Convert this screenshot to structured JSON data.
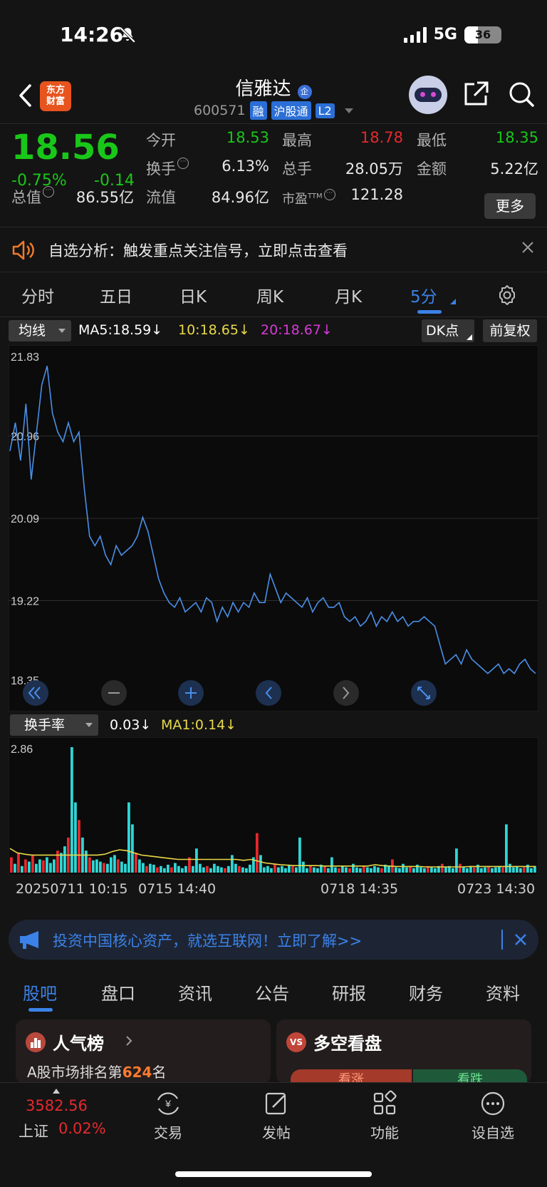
{
  "status_bar": {
    "time": "14:26",
    "network": "5G",
    "battery": "36"
  },
  "header": {
    "logo_line1": "东方",
    "logo_line2": "财富",
    "stock_name": "信雅达",
    "stock_badge": "企",
    "code": "600571",
    "tags": [
      "融",
      "沪股通",
      "L2"
    ]
  },
  "quote": {
    "price": "18.56",
    "change_pct": "-0.75%",
    "change_abs": "-0.14",
    "total_value_label": "总值",
    "total_value": "86.55亿",
    "rows": [
      [
        {
          "label": "今开",
          "value": "18.53",
          "color": "green"
        },
        {
          "label": "最高",
          "value": "18.78",
          "color": "red"
        },
        {
          "label": "最低",
          "value": "18.35",
          "color": "green"
        }
      ],
      [
        {
          "label": "换手",
          "value": "6.13%",
          "color": "white"
        },
        {
          "label": "总手",
          "value": "28.05万",
          "color": "white"
        },
        {
          "label": "金额",
          "value": "5.22亿",
          "color": "white"
        }
      ],
      [
        {
          "label": "流值",
          "value": "84.96亿",
          "color": "white"
        },
        {
          "label": "市盈",
          "value": "121.28",
          "color": "white"
        }
      ]
    ],
    "pe_superscript": "TTM",
    "more_label": "更多"
  },
  "notice": {
    "text": "自选分析：触发重点关注信号，立即点击查看"
  },
  "chart_tabs": {
    "items": [
      "分时",
      "五日",
      "日K",
      "周K",
      "月K",
      "5分"
    ],
    "active": "5分"
  },
  "ma_row": {
    "dropdown": "均线",
    "ma5": "MA5:18.59",
    "ma10": "10:18.65",
    "ma20": "20:18.67",
    "arrow": "↓",
    "dk_label": "DK点",
    "fq_label": "前复权"
  },
  "vol_row": {
    "dropdown": "换手率",
    "value": "0.03",
    "ma_label": "MA1:0.14",
    "arrow": "↓"
  },
  "x_labels": [
    "20250711 10:15",
    "0715 14:40",
    "0718 14:35",
    "0723 14:30"
  ],
  "ad": {
    "text": "投资中国核心资产，就选互联网！立即了解>>"
  },
  "section_tabs": {
    "items": [
      "股吧",
      "盘口",
      "资讯",
      "公告",
      "研报",
      "财务",
      "资料"
    ],
    "active": "股吧"
  },
  "cards": {
    "popularity_title": "人气榜",
    "popularity_sub_prefix": "A股市场排名第",
    "popularity_rank": "624",
    "popularity_sub_suffix": "名",
    "longshort_title": "多空看盘",
    "longshort_badge": "VS",
    "up_label": "看涨",
    "down_label": "看跌"
  },
  "bottom_bar": {
    "index_value": "3582.56",
    "index_name": "上证",
    "index_pct": "0.02%",
    "items": [
      "交易",
      "发帖",
      "功能",
      "设自选"
    ]
  },
  "colors": {
    "up": "#e5292e",
    "down": "#19c719",
    "accent": "#3b82e8",
    "price_line": "#4a8fe8",
    "ma_yellow": "#e8d84a",
    "ma_magenta": "#d63ad6",
    "vol_cyan": "#2fd6d6"
  },
  "chart_data": [
    {
      "type": "line",
      "title": "",
      "y_ticks": [
        "21.83",
        "20.96",
        "20.09",
        "19.22",
        "18.35"
      ],
      "ylim": [
        18.35,
        21.83
      ],
      "x_tick_labels": [
        "20250711 10:15",
        "0715 14:40",
        "0718 14:35",
        "0723 14:30"
      ],
      "series": [
        {
          "values": [
            20.8,
            21.1,
            20.7,
            21.3,
            20.5,
            21.0,
            21.5,
            21.7,
            21.2,
            21.0,
            20.9,
            21.1,
            20.9,
            21.0,
            20.4,
            19.9,
            19.8,
            19.9,
            19.7,
            19.6,
            19.8,
            19.7,
            19.75,
            19.8,
            19.9,
            20.1,
            19.95,
            19.7,
            19.45,
            19.3,
            19.2,
            19.15,
            19.25,
            19.1,
            19.15,
            19.2,
            19.1,
            19.25,
            19.2,
            19.0,
            19.15,
            19.05,
            19.2,
            19.1,
            19.2,
            19.15,
            19.3,
            19.2,
            19.2,
            19.5,
            19.35,
            19.2,
            19.3,
            19.25,
            19.2,
            19.15,
            19.25,
            19.1,
            19.2,
            19.25,
            19.15,
            19.15,
            19.2,
            19.05,
            19.0,
            19.05,
            18.95,
            19.0,
            19.1,
            18.95,
            19.05,
            19.0,
            19.1,
            19.0,
            19.05,
            18.95,
            19.0,
            19.0,
            19.05,
            19.0,
            18.95,
            18.75,
            18.55,
            18.6,
            18.65,
            18.55,
            18.7,
            18.6,
            18.55,
            18.5,
            18.45,
            18.5,
            18.55,
            18.45,
            18.5,
            18.45,
            18.55,
            18.6,
            18.5,
            18.45
          ]
        }
      ]
    },
    {
      "type": "bar",
      "title": "",
      "y_ticks": [
        "2.86"
      ],
      "ylim": [
        0,
        2.86
      ],
      "series": [
        {
          "name": "换手率",
          "values": [
            0.35,
            0.2,
            0.45,
            0.15,
            0.3,
            0.25,
            0.4,
            0.2,
            0.3,
            0.28,
            0.35,
            0.22,
            0.3,
            0.5,
            0.45,
            0.6,
            0.8,
            2.86,
            1.6,
            1.2,
            0.8,
            0.5,
            0.35,
            0.28,
            0.3,
            0.25,
            0.22,
            0.2,
            0.35,
            0.4,
            0.3,
            0.25,
            0.2,
            1.6,
            1.1,
            0.45,
            0.3,
            0.22,
            0.15,
            0.2,
            0.18,
            0.12,
            0.15,
            0.1,
            0.18,
            0.12,
            0.22,
            0.15,
            0.1,
            0.15,
            0.35,
            0.15,
            0.55,
            0.2,
            0.12,
            0.15,
            0.1,
            0.2,
            0.15,
            0.12,
            0.1,
            0.15,
            0.4,
            0.2,
            0.15,
            0.12,
            0.1,
            0.18,
            0.35,
            0.9,
            0.4,
            0.12,
            0.15,
            0.1,
            0.2,
            0.12,
            0.15,
            0.1,
            0.18,
            0.15,
            0.12,
            0.8,
            0.25,
            0.1,
            0.15,
            0.12,
            0.1,
            0.18,
            0.15,
            0.1,
            0.35,
            0.12,
            0.1,
            0.15,
            0.12,
            0.1,
            0.2,
            0.12,
            0.1,
            0.15,
            0.12,
            0.1,
            0.15,
            0.12,
            0.1,
            0.18,
            0.15,
            0.3,
            0.12,
            0.1,
            0.2,
            0.12,
            0.15,
            0.1,
            0.18,
            0.12,
            0.1,
            0.15,
            0.12,
            0.1,
            0.15,
            0.2,
            0.12,
            0.15,
            0.1,
            0.55,
            0.2,
            0.12,
            0.1,
            0.15,
            0.12,
            0.18,
            0.1,
            0.12,
            0.15,
            0.1,
            0.12,
            0.15,
            0.12,
            1.1,
            0.2,
            0.12,
            0.15,
            0.1,
            0.12,
            0.18,
            0.1,
            0.15
          ],
          "colors_up": [
            0,
            2,
            4,
            6,
            9,
            13,
            16,
            19,
            22,
            26,
            30,
            35,
            38,
            41,
            45,
            50,
            55,
            60,
            64,
            69,
            74,
            79,
            84,
            88,
            92,
            95,
            99,
            104,
            107,
            112,
            117,
            121,
            126,
            130,
            134,
            138,
            144,
            148
          ]
        },
        {
          "name": "MA1:0.14",
          "values": [
            0.55,
            0.45,
            0.42,
            0.4,
            0.4,
            0.4,
            0.4,
            0.4,
            0.4,
            0.4,
            0.4,
            0.4,
            0.4,
            0.42,
            0.48,
            0.52,
            0.5,
            0.45,
            0.4,
            0.38,
            0.36,
            0.34,
            0.32,
            0.3,
            0.3,
            0.3,
            0.3,
            0.3,
            0.3,
            0.3,
            0.3,
            0.3,
            0.28,
            0.3,
            0.26,
            0.22,
            0.2,
            0.18,
            0.17,
            0.16,
            0.16,
            0.16,
            0.16,
            0.15,
            0.15,
            0.15,
            0.15,
            0.15,
            0.15,
            0.15,
            0.18,
            0.16,
            0.15,
            0.14,
            0.14,
            0.14,
            0.14,
            0.13,
            0.13,
            0.13,
            0.13,
            0.13,
            0.13,
            0.14,
            0.14,
            0.14,
            0.14,
            0.14,
            0.14,
            0.14,
            0.14,
            0.14,
            0.14
          ]
        }
      ]
    }
  ]
}
